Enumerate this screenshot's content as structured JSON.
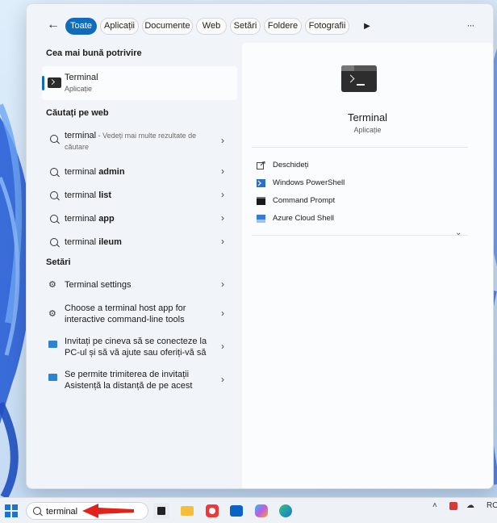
{
  "filters": {
    "back_icon": "arrow-left-icon",
    "chips": [
      {
        "label": "Toate",
        "active": true
      },
      {
        "label": "Aplicații",
        "active": false
      },
      {
        "label": "Documente",
        "active": false
      },
      {
        "label": "Web",
        "active": false
      },
      {
        "label": "Setări",
        "active": false
      },
      {
        "label": "Foldere",
        "active": false
      },
      {
        "label": "Fotografii",
        "active": false
      }
    ],
    "more_icon": "play-icon",
    "overflow_label": "···"
  },
  "best_match": {
    "section": "Cea mai bună potrivire",
    "title": "Terminal",
    "subtitle": "Aplicație"
  },
  "web": {
    "section": "Căutați pe web",
    "items": [
      {
        "prefix": "terminal",
        "bold": "",
        "dim": " - Vedeți mai multe rezultate de",
        "line2": "căutare"
      },
      {
        "prefix": "terminal ",
        "bold": "admin"
      },
      {
        "prefix": "terminal ",
        "bold": "list"
      },
      {
        "prefix": "terminal ",
        "bold": "app"
      },
      {
        "prefix": "terminal ",
        "bold": "ileum"
      }
    ]
  },
  "settings": {
    "section": "Setări",
    "items": [
      {
        "line1": "Terminal settings",
        "line2": ""
      },
      {
        "line1": "Choose a terminal host app for",
        "line2": "interactive command-line tools"
      },
      {
        "line1": "Invitați pe cineva să se conecteze la",
        "line2": "PC-ul și să vă ajute sau oferiți-vă să"
      },
      {
        "line1": "Se permite trimiterea de invitații",
        "line2": "Asistență la distanță de pe acest"
      }
    ]
  },
  "preview": {
    "title": "Terminal",
    "subtitle": "Aplicație",
    "actions": [
      {
        "label": "Deschideți",
        "icon": "open-external-icon"
      },
      {
        "label": "Windows PowerShell",
        "icon": "powershell-icon"
      },
      {
        "label": "Command Prompt",
        "icon": "command-prompt-icon"
      },
      {
        "label": "Azure Cloud Shell",
        "icon": "azure-cloud-shell-icon"
      }
    ]
  },
  "taskbar": {
    "search_value": "terminal",
    "tray_lang": "RO"
  },
  "colors": {
    "accent": "#0f6cbd",
    "annotation_arrow": "#e3231b"
  }
}
